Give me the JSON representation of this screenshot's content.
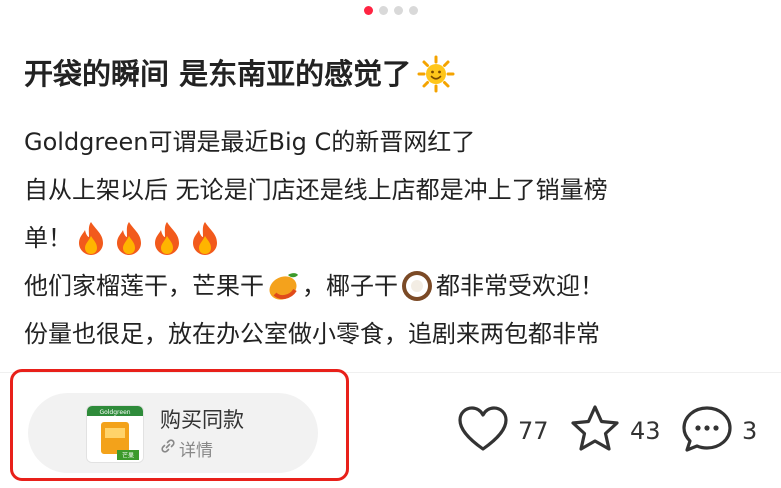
{
  "carousel": {
    "total": 4,
    "active_index": 0
  },
  "post": {
    "title": "开袋的瞬间 是东南亚的感觉了",
    "title_emoji": "sun-emoji",
    "lines": {
      "l1": "Goldgreen可谓是最近Big C的新晋网红了",
      "l2": "自从上架以后 无论是门店还是线上店都是冲上了销量榜",
      "l3": "单！",
      "l4a": "他们家榴莲干，芒果干",
      "l4b": "，椰子干",
      "l4c": "都非常受欢迎！",
      "l5": "份量也很足，放在办公室做小零食，追剧来两包都非常"
    }
  },
  "buy": {
    "label": "购买同款",
    "detail": "详情",
    "thumb_brand": "Goldgreen",
    "thumb_tag": "芒果"
  },
  "stats": {
    "likes": "77",
    "favorites": "43",
    "comments": "3"
  },
  "colors": {
    "accent": "#ff2442",
    "highlight_border": "#e8201a",
    "pill_bg": "#f2f2f2"
  }
}
